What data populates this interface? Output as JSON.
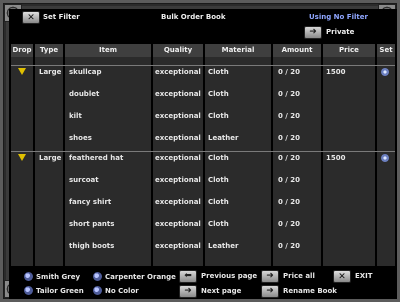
{
  "header": {
    "set_filter_label": "Set Filter",
    "title": "Bulk Order Book",
    "filter_status": "Using No Filter",
    "private_label": "Private"
  },
  "columns": {
    "drop": "Drop",
    "type": "Type",
    "item": "Item",
    "quality": "Quality",
    "material": "Material",
    "amount": "Amount",
    "price": "Price",
    "set": "Set"
  },
  "orders": [
    {
      "type": "Large",
      "price": "1500",
      "items": [
        {
          "item": "skullcap",
          "quality": "exceptional",
          "material": "Cloth",
          "amount": "0 / 20"
        },
        {
          "item": "doublet",
          "quality": "exceptional",
          "material": "Cloth",
          "amount": "0 / 20"
        },
        {
          "item": "kilt",
          "quality": "exceptional",
          "material": "Cloth",
          "amount": "0 / 20"
        },
        {
          "item": "shoes",
          "quality": "exceptional",
          "material": "Leather",
          "amount": "0 / 20"
        }
      ]
    },
    {
      "type": "Large",
      "price": "1500",
      "items": [
        {
          "item": "feathered hat",
          "quality": "exceptional",
          "material": "Cloth",
          "amount": "0 / 20"
        },
        {
          "item": "surcoat",
          "quality": "exceptional",
          "material": "Cloth",
          "amount": "0 / 20"
        },
        {
          "item": "fancy shirt",
          "quality": "exceptional",
          "material": "Cloth",
          "amount": "0 / 20"
        },
        {
          "item": "short pants",
          "quality": "exceptional",
          "material": "Cloth",
          "amount": "0 / 20"
        },
        {
          "item": "thigh boots",
          "quality": "exceptional",
          "material": "Leather",
          "amount": "0 / 20"
        }
      ]
    }
  ],
  "footer": {
    "smith_grey": "Smith Grey",
    "tailor_green": "Tailor Green",
    "carpenter_orange": "Carpenter Orange",
    "no_color": "No Color",
    "previous_page": "Previous page",
    "next_page": "Next page",
    "price_all": "Price all",
    "rename_book": "Rename Book",
    "exit": "EXIT"
  },
  "colors": {
    "filter_status": "#8fa6ff",
    "drop_marker": "#e0c000",
    "background": "#000000",
    "column_bg": "#2b2b2b"
  }
}
